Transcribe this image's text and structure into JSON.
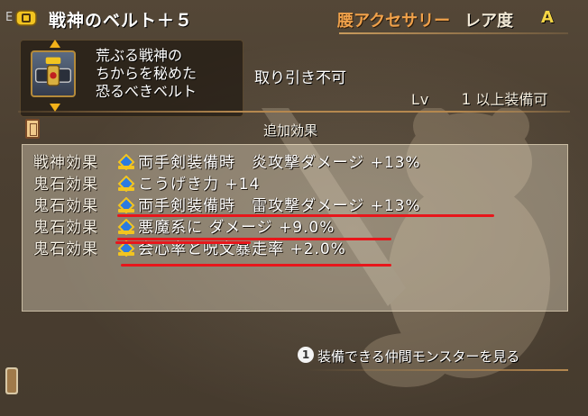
{
  "header": {
    "equip_mark": "E",
    "item_name": "戦神のベルト＋５",
    "category": "腰アクセサリー",
    "rarity_label": "レア度",
    "rarity_value": "A"
  },
  "item": {
    "description": [
      "荒ぶる戦神の",
      "ちからを秘めた",
      "恐るべきベルト"
    ],
    "trade_status": "取り引き不可",
    "level_label": "Lv",
    "level_value": "1",
    "level_suffix": "以上装備可"
  },
  "effects": {
    "title": "追加効果",
    "rows": [
      {
        "type": "戦神効果",
        "text": "両手剣装備時　炎攻撃ダメージ +13%"
      },
      {
        "type": "鬼石効果",
        "text": "こうげき力 +14"
      },
      {
        "type": "鬼石効果",
        "text": "両手剣装備時　雷攻撃ダメージ +13%"
      },
      {
        "type": "鬼石効果",
        "text": "悪魔系に ダメージ +9.0%"
      },
      {
        "type": "鬼石効果",
        "text": "会心率と呪文暴走率 +2.0%"
      }
    ]
  },
  "footer": {
    "button_glyph": "1",
    "text": "装備できる仲間モンスターを見る"
  },
  "colors": {
    "category": "#f0a14a",
    "rarity": "#f5d545",
    "highlight": "#e8161b"
  }
}
